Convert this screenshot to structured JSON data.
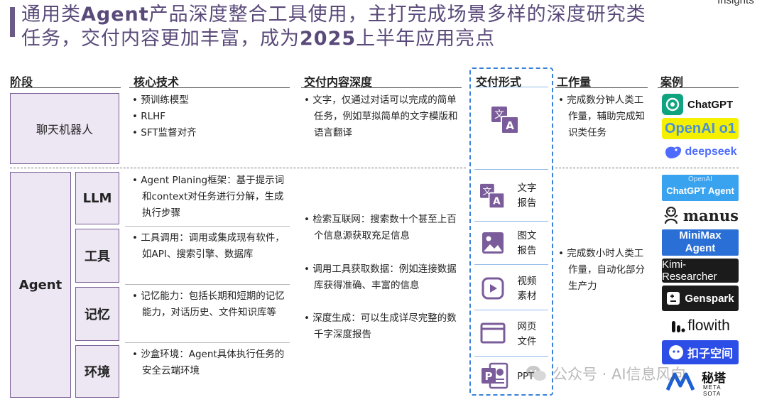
{
  "top_right": "Insights",
  "title_line1_a": "通用类",
  "title_line1_b": "Agent",
  "title_line1_c": "产品深度整合工具使用，主打完成场景多样的深度研究类",
  "title_line2_a": "任务，交付内容更加丰富，成为",
  "title_line2_b": "2025",
  "title_line2_c": "上半年应用亮点",
  "headers": {
    "stage": "阶段",
    "core_tech": "核心技术",
    "depth": "交付内容深度",
    "form": "交付形式",
    "workload": "工作量",
    "cases": "案例"
  },
  "chatbot": {
    "label": "聊天机器人",
    "tech": [
      "• 预训练模型",
      "• RLHF",
      "• SFT监督对齐"
    ],
    "depth": "• 文字，仅通过对话可以完成的简单任务，例如草拟简单的文字模版和语言翻译",
    "workload": "• 完成数分钟人类工作量，辅助完成知识类任务",
    "cases": [
      "ChatGPT",
      "OpenAI o1",
      "deepseek"
    ]
  },
  "agent": {
    "label": "Agent",
    "rows": [
      {
        "label": "LLM",
        "tech": "• Agent Planing框架：基于提示词和context对任务进行分解，生成执行步骤"
      },
      {
        "label": "工具",
        "tech": "• 工具调用：调用或集成现有软件，如API、搜索引擎、数据库"
      },
      {
        "label": "记忆",
        "tech": "• 记忆能力：包括长期和短期的记忆能力，对话历史、文件知识库等"
      },
      {
        "label": "环境",
        "tech": "• 沙盒环境：Agent具体执行任务的安全云端环境"
      }
    ],
    "depth": [
      "• 检索互联网：搜索数十个甚至上百个信息源获取充足信息",
      "• 调用工具获取数据：例如连接数据库获得准确、丰富的信息",
      "• 深度生成：可以生成详尽完整的数千字深度报告"
    ],
    "forms": [
      {
        "line1": "文字",
        "line2": "报告",
        "icon": "translate-icon"
      },
      {
        "line1": "图文",
        "line2": "报告",
        "icon": "image-icon"
      },
      {
        "line1": "视频",
        "line2": "素材",
        "icon": "video-icon"
      },
      {
        "line1": "网页",
        "line2": "文件",
        "icon": "webpage-icon"
      },
      {
        "line1": "PPT",
        "line2": "",
        "icon": "powerpoint-icon"
      }
    ],
    "workload": "• 完成数小时人类工作量，自动化部分生产力",
    "cases": {
      "chatgpt_agent_top": "OpenAI",
      "chatgpt_agent": "ChatGPT Agent",
      "manus": "manus",
      "minimax_1": "MiniMax",
      "minimax_2": "Agent",
      "kimi": "Kimi-Researcher",
      "genspark": "Genspark",
      "flowith": "flowith",
      "kouzi": "扣子空间"
    }
  },
  "watermark": "公众号 · AI信息风向",
  "metasota_1": "秘塔",
  "metasota_2": "META SOTA"
}
